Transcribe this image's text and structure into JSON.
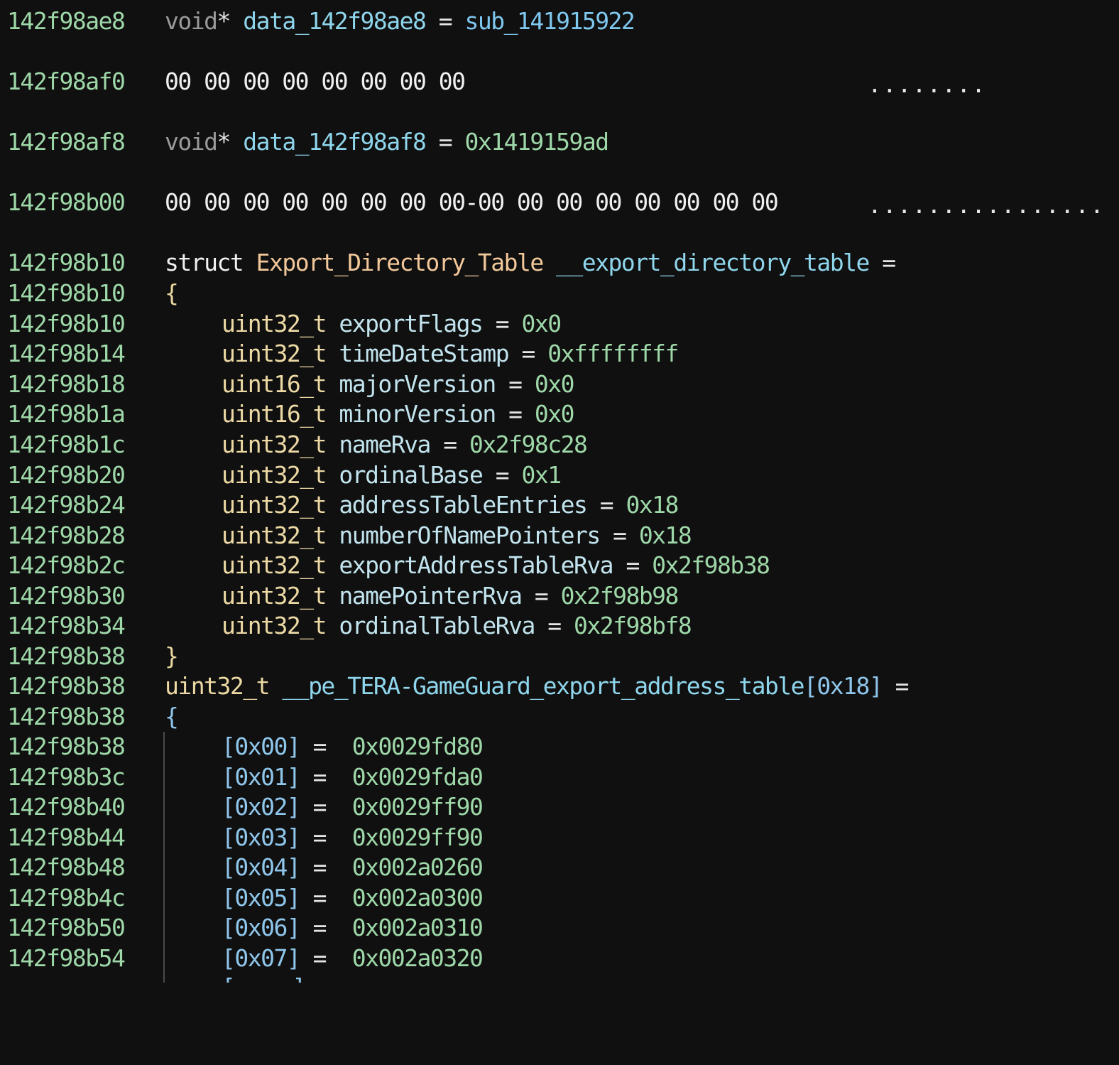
{
  "colors": {
    "background": "#101010",
    "address": "#9ed8a8",
    "symbol": "#8fd6ec",
    "struct_type": "#f2c89a",
    "primitive_type": "#ecd9a4",
    "field": "#c2e4ee",
    "number": "#9ed8a8"
  },
  "lines": {
    "l0": {
      "addr": "142f98ae8",
      "type": "void",
      "star": "*",
      "name": "data_142f98ae8",
      "eq": "=",
      "value": "sub_141915922"
    },
    "l1": {
      "addr": "142f98af0",
      "bytes": "00 00 00 00 00 00 00 00",
      "ascii": "........"
    },
    "l2": {
      "addr": "142f98af8",
      "type": "void",
      "star": "*",
      "name": "data_142f98af8",
      "eq": "=",
      "value": "0x1419159ad"
    },
    "l3": {
      "addr": "142f98b00",
      "bytes": "00 00 00 00 00 00 00 00-00 00 00 00 00 00 00 00",
      "ascii": "................"
    },
    "l4": {
      "addr": "142f98b10",
      "kw": "struct",
      "type": "Export_Directory_Table",
      "name": "__export_directory_table",
      "eq": "="
    },
    "l5": {
      "addr": "142f98b10",
      "brace": "{"
    },
    "fields": [
      {
        "addr": "142f98b10",
        "type": "uint32_t",
        "name": "exportFlags",
        "eq": "=",
        "value": "0x0"
      },
      {
        "addr": "142f98b14",
        "type": "uint32_t",
        "name": "timeDateStamp",
        "eq": "=",
        "value": "0xffffffff"
      },
      {
        "addr": "142f98b18",
        "type": "uint16_t",
        "name": "majorVersion",
        "eq": "=",
        "value": "0x0"
      },
      {
        "addr": "142f98b1a",
        "type": "uint16_t",
        "name": "minorVersion",
        "eq": "=",
        "value": "0x0"
      },
      {
        "addr": "142f98b1c",
        "type": "uint32_t",
        "name": "nameRva",
        "eq": "=",
        "value": "0x2f98c28"
      },
      {
        "addr": "142f98b20",
        "type": "uint32_t",
        "name": "ordinalBase",
        "eq": "=",
        "value": "0x1"
      },
      {
        "addr": "142f98b24",
        "type": "uint32_t",
        "name": "addressTableEntries",
        "eq": "=",
        "value": "0x18"
      },
      {
        "addr": "142f98b28",
        "type": "uint32_t",
        "name": "numberOfNamePointers",
        "eq": "=",
        "value": "0x18"
      },
      {
        "addr": "142f98b2c",
        "type": "uint32_t",
        "name": "exportAddressTableRva",
        "eq": "=",
        "value": "0x2f98b38"
      },
      {
        "addr": "142f98b30",
        "type": "uint32_t",
        "name": "namePointerRva",
        "eq": "=",
        "value": "0x2f98b98"
      },
      {
        "addr": "142f98b34",
        "type": "uint32_t",
        "name": "ordinalTableRva",
        "eq": "=",
        "value": "0x2f98bf8"
      }
    ],
    "l17": {
      "addr": "142f98b38",
      "brace": "}"
    },
    "l18": {
      "addr": "142f98b38",
      "type": "uint32_t",
      "name": "__pe_TERA-GameGuard_export_address_table",
      "dim": "[0x18]",
      "eq": "="
    },
    "l19": {
      "addr": "142f98b38",
      "brace": "{"
    },
    "entries": [
      {
        "addr": "142f98b38",
        "index": "[0x00]",
        "eq": "=",
        "value": "0x0029fd80"
      },
      {
        "addr": "142f98b3c",
        "index": "[0x01]",
        "eq": "=",
        "value": "0x0029fda0"
      },
      {
        "addr": "142f98b40",
        "index": "[0x02]",
        "eq": "=",
        "value": "0x0029ff90"
      },
      {
        "addr": "142f98b44",
        "index": "[0x03]",
        "eq": "=",
        "value": "0x0029ff90"
      },
      {
        "addr": "142f98b48",
        "index": "[0x04]",
        "eq": "=",
        "value": "0x002a0260"
      },
      {
        "addr": "142f98b4c",
        "index": "[0x05]",
        "eq": "=",
        "value": "0x002a0300"
      },
      {
        "addr": "142f98b50",
        "index": "[0x06]",
        "eq": "=",
        "value": "0x002a0310"
      },
      {
        "addr": "142f98b54",
        "index": "[0x07]",
        "eq": "=",
        "value": "0x002a0320"
      }
    ]
  }
}
